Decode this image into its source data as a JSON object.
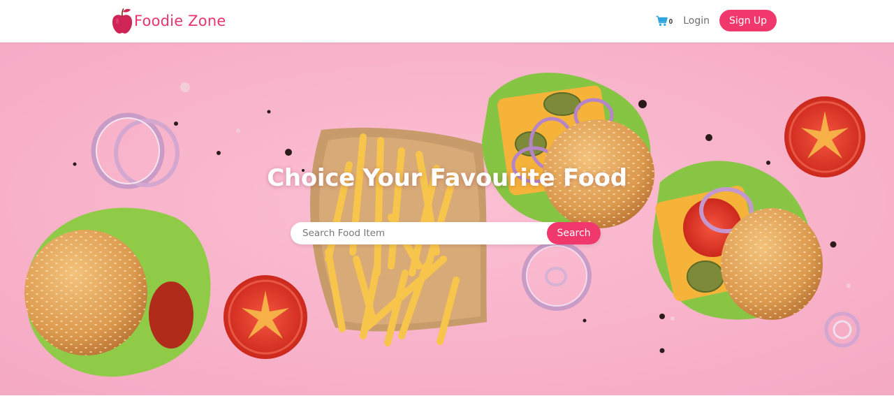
{
  "brand": {
    "name": "Foodie Zone",
    "icon": "apple-icon",
    "color": "#e8356d"
  },
  "nav": {
    "cart_icon": "shopping-cart-icon",
    "cart_count": "0",
    "login_label": "Login",
    "signup_label": "Sign Up"
  },
  "hero": {
    "title": "Choice Your Favourite Food",
    "background": "pink backdrop with burgers, tomatoes, onion rings and french fries",
    "search": {
      "placeholder": "Search Food Item",
      "value": "",
      "button_label": "Search"
    }
  },
  "colors": {
    "accent": "#f0386c",
    "hero_background": "#f8b4cc",
    "text_muted": "#6e6e6e"
  }
}
